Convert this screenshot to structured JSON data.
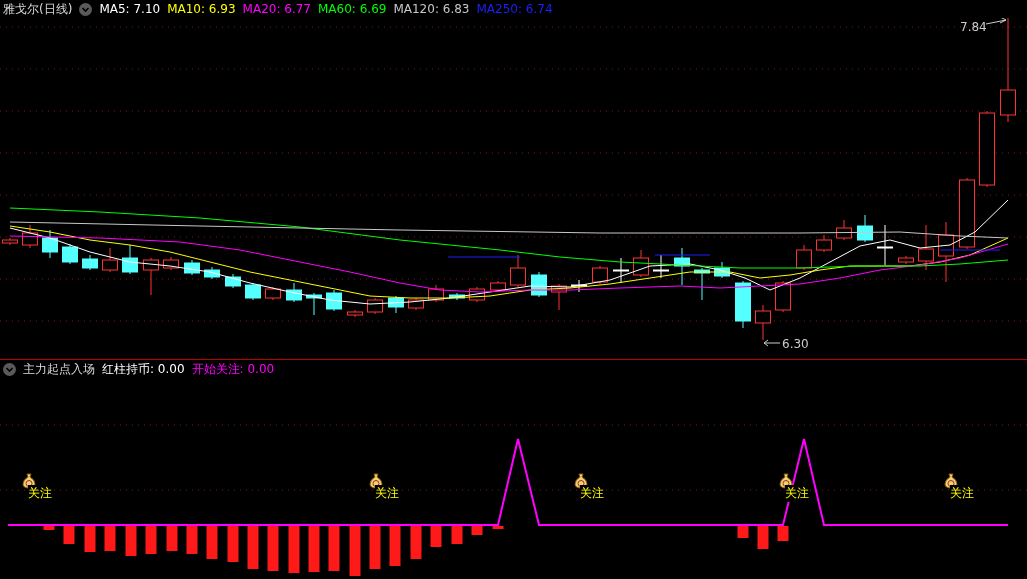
{
  "chart": {
    "title": "雅戈尔(日线)",
    "moving_averages": [
      {
        "label": "MA5:",
        "value": "7.10",
        "color": "#ffffff"
      },
      {
        "label": "MA10:",
        "value": "6.93",
        "color": "#ffff00"
      },
      {
        "label": "MA20:",
        "value": "6.77",
        "color": "#ff00ff"
      },
      {
        "label": "MA60:",
        "value": "6.69",
        "color": "#00ff00"
      },
      {
        "label": "MA120:",
        "value": "6.83",
        "color": "#c8c8c8"
      },
      {
        "label": "MA250:",
        "value": "6.74",
        "color": "#1e1eff"
      }
    ],
    "high_label": "7.84",
    "low_label": "6.30"
  },
  "indicator": {
    "name": "主力起点入场",
    "values": [
      {
        "label": "红柱持币:",
        "value": "0.00",
        "color": "#ffffff"
      },
      {
        "label": "开始关注:",
        "value": "0.00",
        "color": "#ff00ff"
      }
    ],
    "signals": [
      "关注",
      "关注",
      "关注",
      "关注",
      "关注"
    ]
  }
}
